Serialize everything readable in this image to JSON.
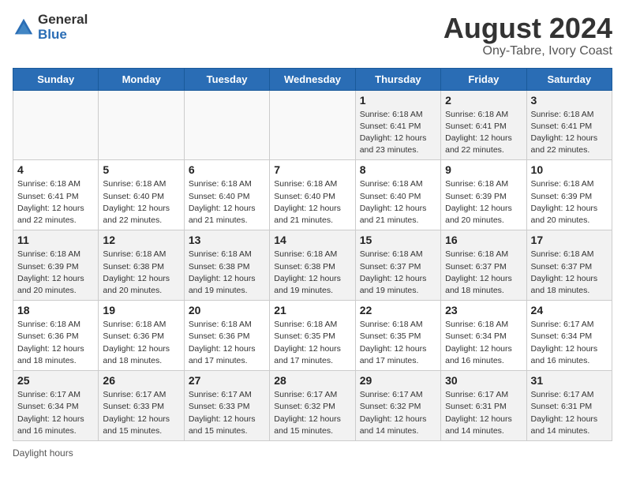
{
  "header": {
    "logo_general": "General",
    "logo_blue": "Blue",
    "title": "August 2024",
    "subtitle": "Ony-Tabre, Ivory Coast"
  },
  "days_of_week": [
    "Sunday",
    "Monday",
    "Tuesday",
    "Wednesday",
    "Thursday",
    "Friday",
    "Saturday"
  ],
  "weeks": [
    [
      {
        "day": "",
        "info": ""
      },
      {
        "day": "",
        "info": ""
      },
      {
        "day": "",
        "info": ""
      },
      {
        "day": "",
        "info": ""
      },
      {
        "day": "1",
        "info": "Sunrise: 6:18 AM\nSunset: 6:41 PM\nDaylight: 12 hours and 23 minutes."
      },
      {
        "day": "2",
        "info": "Sunrise: 6:18 AM\nSunset: 6:41 PM\nDaylight: 12 hours and 22 minutes."
      },
      {
        "day": "3",
        "info": "Sunrise: 6:18 AM\nSunset: 6:41 PM\nDaylight: 12 hours and 22 minutes."
      }
    ],
    [
      {
        "day": "4",
        "info": "Sunrise: 6:18 AM\nSunset: 6:41 PM\nDaylight: 12 hours and 22 minutes."
      },
      {
        "day": "5",
        "info": "Sunrise: 6:18 AM\nSunset: 6:40 PM\nDaylight: 12 hours and 22 minutes."
      },
      {
        "day": "6",
        "info": "Sunrise: 6:18 AM\nSunset: 6:40 PM\nDaylight: 12 hours and 21 minutes."
      },
      {
        "day": "7",
        "info": "Sunrise: 6:18 AM\nSunset: 6:40 PM\nDaylight: 12 hours and 21 minutes."
      },
      {
        "day": "8",
        "info": "Sunrise: 6:18 AM\nSunset: 6:40 PM\nDaylight: 12 hours and 21 minutes."
      },
      {
        "day": "9",
        "info": "Sunrise: 6:18 AM\nSunset: 6:39 PM\nDaylight: 12 hours and 20 minutes."
      },
      {
        "day": "10",
        "info": "Sunrise: 6:18 AM\nSunset: 6:39 PM\nDaylight: 12 hours and 20 minutes."
      }
    ],
    [
      {
        "day": "11",
        "info": "Sunrise: 6:18 AM\nSunset: 6:39 PM\nDaylight: 12 hours and 20 minutes."
      },
      {
        "day": "12",
        "info": "Sunrise: 6:18 AM\nSunset: 6:38 PM\nDaylight: 12 hours and 20 minutes."
      },
      {
        "day": "13",
        "info": "Sunrise: 6:18 AM\nSunset: 6:38 PM\nDaylight: 12 hours and 19 minutes."
      },
      {
        "day": "14",
        "info": "Sunrise: 6:18 AM\nSunset: 6:38 PM\nDaylight: 12 hours and 19 minutes."
      },
      {
        "day": "15",
        "info": "Sunrise: 6:18 AM\nSunset: 6:37 PM\nDaylight: 12 hours and 19 minutes."
      },
      {
        "day": "16",
        "info": "Sunrise: 6:18 AM\nSunset: 6:37 PM\nDaylight: 12 hours and 18 minutes."
      },
      {
        "day": "17",
        "info": "Sunrise: 6:18 AM\nSunset: 6:37 PM\nDaylight: 12 hours and 18 minutes."
      }
    ],
    [
      {
        "day": "18",
        "info": "Sunrise: 6:18 AM\nSunset: 6:36 PM\nDaylight: 12 hours and 18 minutes."
      },
      {
        "day": "19",
        "info": "Sunrise: 6:18 AM\nSunset: 6:36 PM\nDaylight: 12 hours and 18 minutes."
      },
      {
        "day": "20",
        "info": "Sunrise: 6:18 AM\nSunset: 6:36 PM\nDaylight: 12 hours and 17 minutes."
      },
      {
        "day": "21",
        "info": "Sunrise: 6:18 AM\nSunset: 6:35 PM\nDaylight: 12 hours and 17 minutes."
      },
      {
        "day": "22",
        "info": "Sunrise: 6:18 AM\nSunset: 6:35 PM\nDaylight: 12 hours and 17 minutes."
      },
      {
        "day": "23",
        "info": "Sunrise: 6:18 AM\nSunset: 6:34 PM\nDaylight: 12 hours and 16 minutes."
      },
      {
        "day": "24",
        "info": "Sunrise: 6:17 AM\nSunset: 6:34 PM\nDaylight: 12 hours and 16 minutes."
      }
    ],
    [
      {
        "day": "25",
        "info": "Sunrise: 6:17 AM\nSunset: 6:34 PM\nDaylight: 12 hours and 16 minutes."
      },
      {
        "day": "26",
        "info": "Sunrise: 6:17 AM\nSunset: 6:33 PM\nDaylight: 12 hours and 15 minutes."
      },
      {
        "day": "27",
        "info": "Sunrise: 6:17 AM\nSunset: 6:33 PM\nDaylight: 12 hours and 15 minutes."
      },
      {
        "day": "28",
        "info": "Sunrise: 6:17 AM\nSunset: 6:32 PM\nDaylight: 12 hours and 15 minutes."
      },
      {
        "day": "29",
        "info": "Sunrise: 6:17 AM\nSunset: 6:32 PM\nDaylight: 12 hours and 14 minutes."
      },
      {
        "day": "30",
        "info": "Sunrise: 6:17 AM\nSunset: 6:31 PM\nDaylight: 12 hours and 14 minutes."
      },
      {
        "day": "31",
        "info": "Sunrise: 6:17 AM\nSunset: 6:31 PM\nDaylight: 12 hours and 14 minutes."
      }
    ]
  ],
  "footer": {
    "note": "Daylight hours"
  }
}
